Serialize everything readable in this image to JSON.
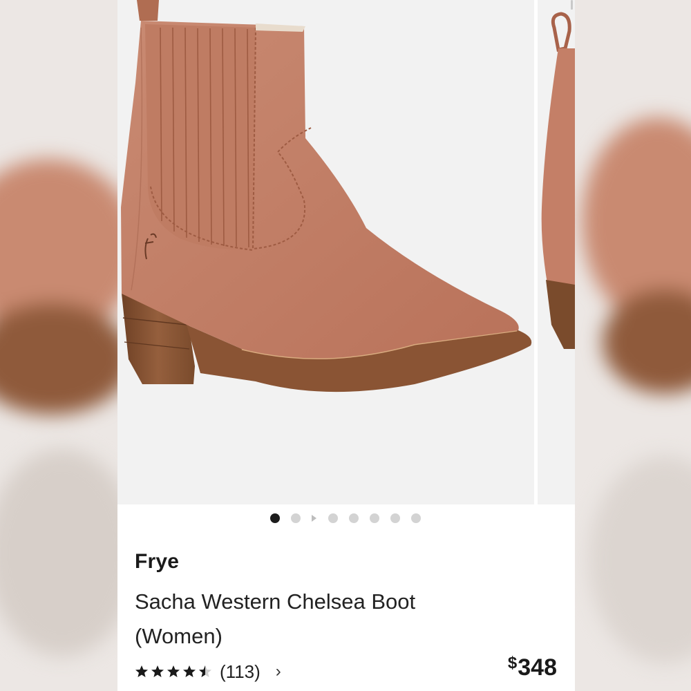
{
  "product": {
    "brand": "Frye",
    "name": "Sacha Western Chelsea Boot (Women)",
    "price_currency": "$",
    "price_amount": "348",
    "rating": 4.5,
    "review_count": "(113)",
    "chevron": "›"
  },
  "carousel": {
    "total_slides": 7,
    "active_index": 0,
    "arrow_after": 1
  },
  "icons": {
    "star": "star-icon",
    "chevron": "chevron-right-icon",
    "logo": "frye-logo-icon"
  },
  "colors": {
    "leather": "#c47f67",
    "sole": "#8a5434",
    "heel": "#7a4b2c",
    "photo_bg": "#f2f2f2",
    "dot_active": "#1c1c1c",
    "dot_inactive": "#d3d3d3"
  }
}
